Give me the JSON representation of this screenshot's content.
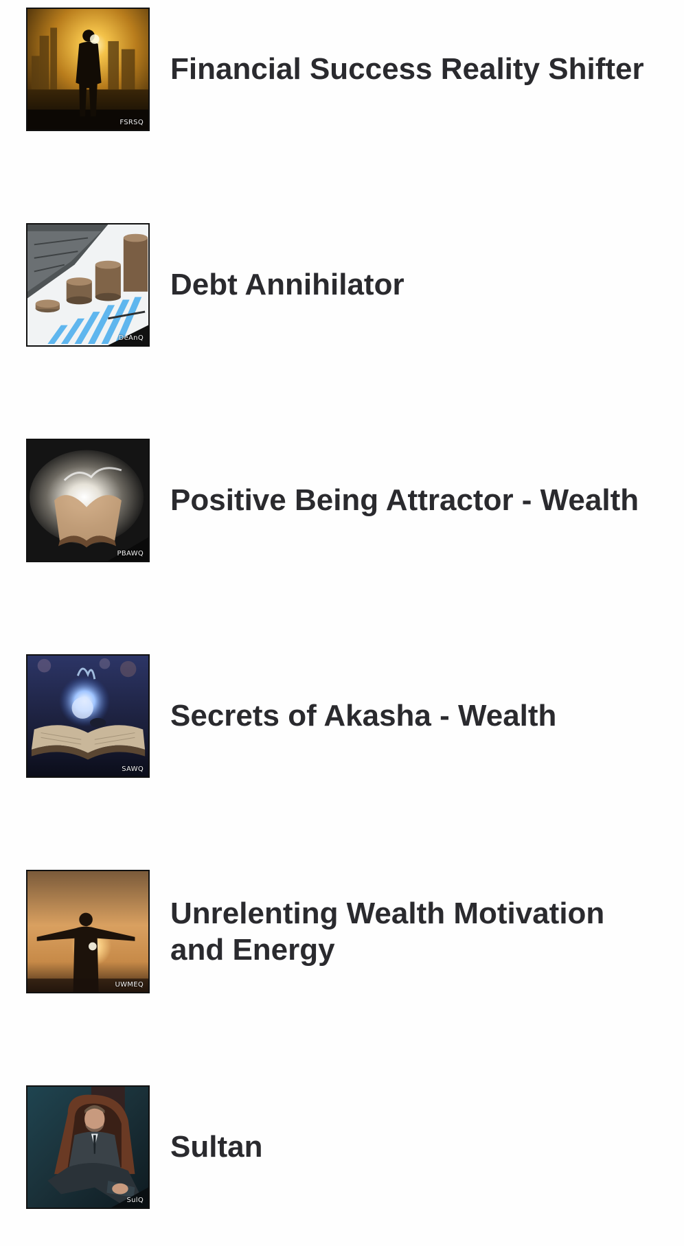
{
  "products": [
    {
      "code": "FSRSQ",
      "title": "Financial Success Reality Shifter",
      "image_icon": "city-sunrise-silhouette-image"
    },
    {
      "code": "DeAnQ",
      "title": "Debt Annihilator",
      "image_icon": "coin-stacks-chart-image"
    },
    {
      "code": "PBAWQ",
      "title": "Positive Being Attractor - Wealth",
      "image_icon": "glowing-book-image"
    },
    {
      "code": "SAWQ",
      "title": "Secrets of Akasha - Wealth",
      "image_icon": "open-book-light-bulb-image"
    },
    {
      "code": "UWMEQ",
      "title": "Unrelenting Wealth Motivation and Energy",
      "image_icon": "man-arms-open-sunset-image"
    },
    {
      "code": "SulQ",
      "title": "Sultan",
      "image_icon": "seated-man-suit-image"
    }
  ],
  "colors": {
    "title_text": "#2a2a2e",
    "page_background": "#fefefe",
    "thumbnail_border": "#111111"
  }
}
